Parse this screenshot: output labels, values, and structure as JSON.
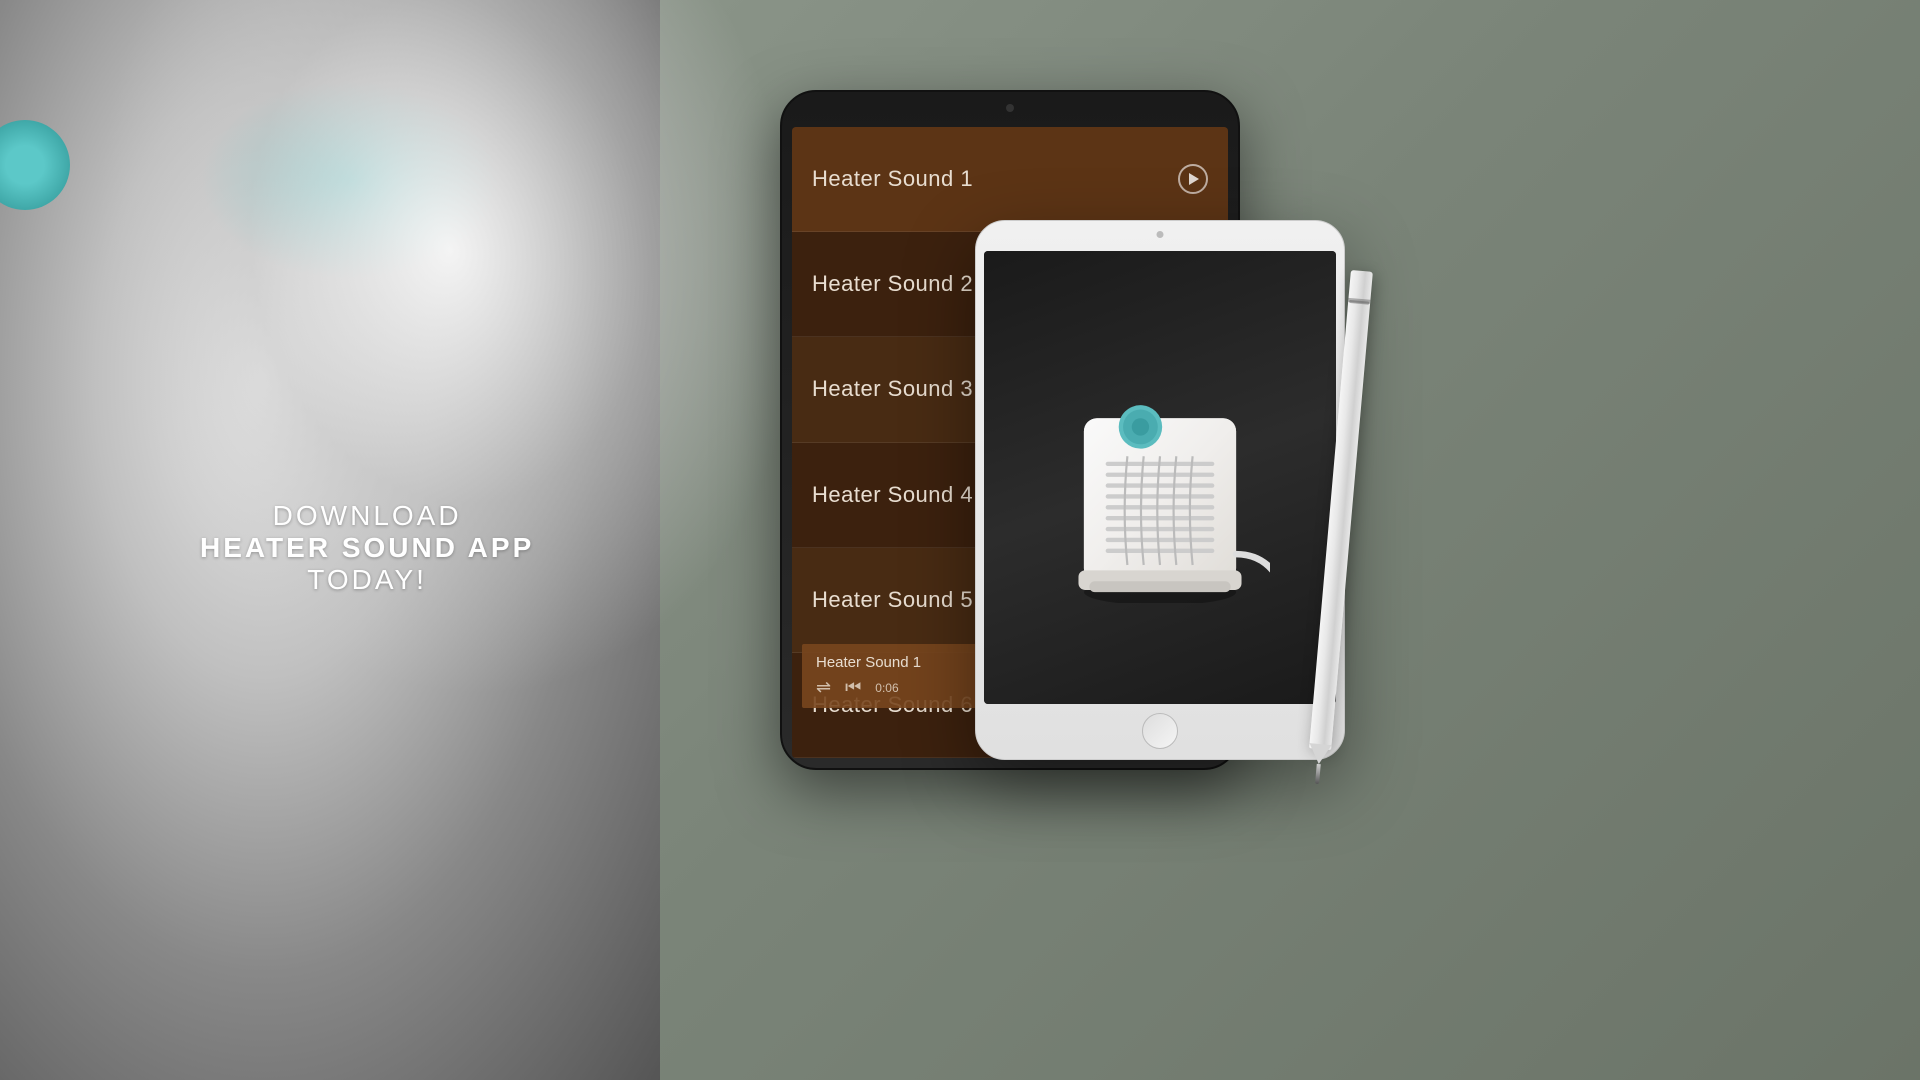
{
  "background": {
    "left_bg": "left-panel",
    "right_bg": "right-panel"
  },
  "download_text": {
    "line1": "DOWNLOAD",
    "line2": "HEATER SOUND APP",
    "line3": "TODAY!"
  },
  "dark_ipad": {
    "sounds": [
      {
        "id": 1,
        "label": "Heater Sound 1",
        "active": true,
        "has_play": true
      },
      {
        "id": 2,
        "label": "Heater Sound 2",
        "active": false,
        "has_play": false
      },
      {
        "id": 3,
        "label": "Heater Sound 3",
        "active": false,
        "has_play": false
      },
      {
        "id": 4,
        "label": "Heater Sound 4",
        "active": false,
        "has_play": false
      },
      {
        "id": 5,
        "label": "Heater Sound 5",
        "active": false,
        "has_play": false
      },
      {
        "id": 6,
        "label": "Heater Sound 6",
        "active": false,
        "has_play": false
      }
    ],
    "now_playing": {
      "track": "Heater Sound 1",
      "time": "0:06"
    }
  },
  "white_ipad": {
    "description": "Heater product image"
  },
  "icons": {
    "shuffle": "⇌",
    "skip_back": "⏮",
    "play": "▶",
    "circle_play": "▶"
  }
}
